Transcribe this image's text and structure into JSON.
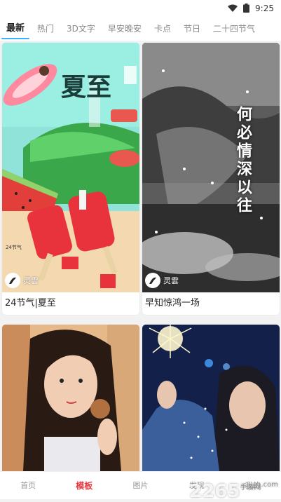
{
  "status_bar": {
    "time": "9:25"
  },
  "tabs": [
    {
      "label": "最新",
      "active": true
    },
    {
      "label": "热门",
      "active": false
    },
    {
      "label": "3D文字",
      "active": false
    },
    {
      "label": "早安晚安",
      "active": false
    },
    {
      "label": "卡点",
      "active": false
    },
    {
      "label": "节日",
      "active": false
    },
    {
      "label": "二十四节气",
      "active": false
    }
  ],
  "cards": [
    {
      "title": "24节气|夏至",
      "author": "灵雲",
      "poster_title": "夏至",
      "poster_tag": "24节气"
    },
    {
      "title": "早知惊鸿一场",
      "author": "灵雲",
      "poster_poem": "何必情深以往"
    },
    {
      "title": "",
      "author": ""
    },
    {
      "title": "",
      "author": ""
    }
  ],
  "bottom_nav": [
    {
      "label": "首页",
      "active": false
    },
    {
      "label": "模板",
      "active": true
    },
    {
      "label": "图片",
      "active": false
    },
    {
      "label": "发现",
      "active": false
    },
    {
      "label": "我的",
      "active": false
    }
  ],
  "watermark": {
    "text": "2265",
    "suffix": ".com",
    "sub": "手游网"
  },
  "colors": {
    "accent_tab": "#3bb1ff",
    "accent_nav": "#e7383f"
  }
}
